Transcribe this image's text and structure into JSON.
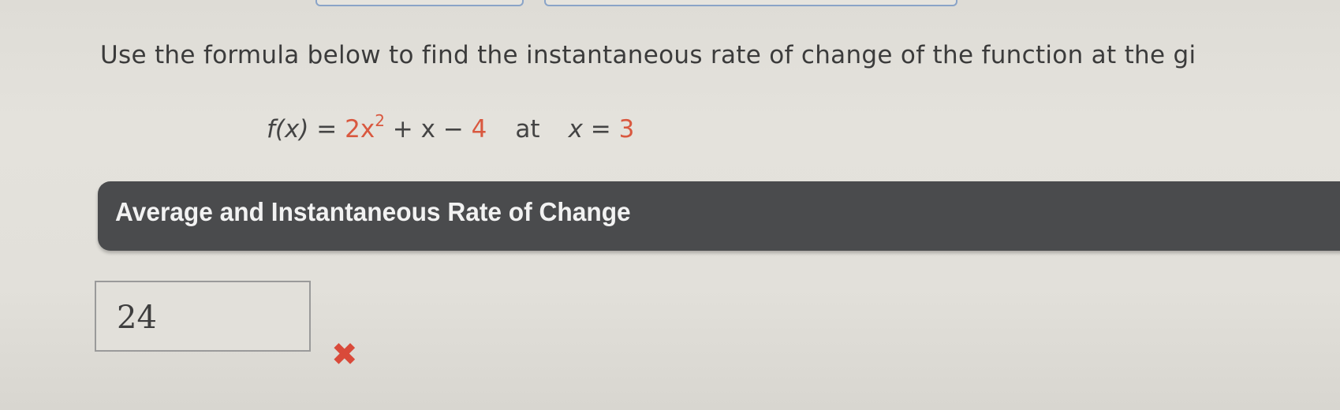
{
  "question": {
    "text": "Use the formula below to find the instantaneous rate of change of the function at the gi"
  },
  "formula": {
    "lhs": "f(x) = ",
    "coef": "2x",
    "exp": "2",
    "middle": " + x − ",
    "const": "4",
    "at_label": "at",
    "var": "x = ",
    "value": "3"
  },
  "banner": {
    "title": "Average and Instantaneous Rate of Change"
  },
  "answer": {
    "value": "24",
    "status_icon": "x-mark-icon",
    "status_glyph": "✖",
    "status_color": "#d94a3a"
  },
  "colors": {
    "highlight": "#d9583f",
    "banner_bg": "#4a4b4d"
  }
}
